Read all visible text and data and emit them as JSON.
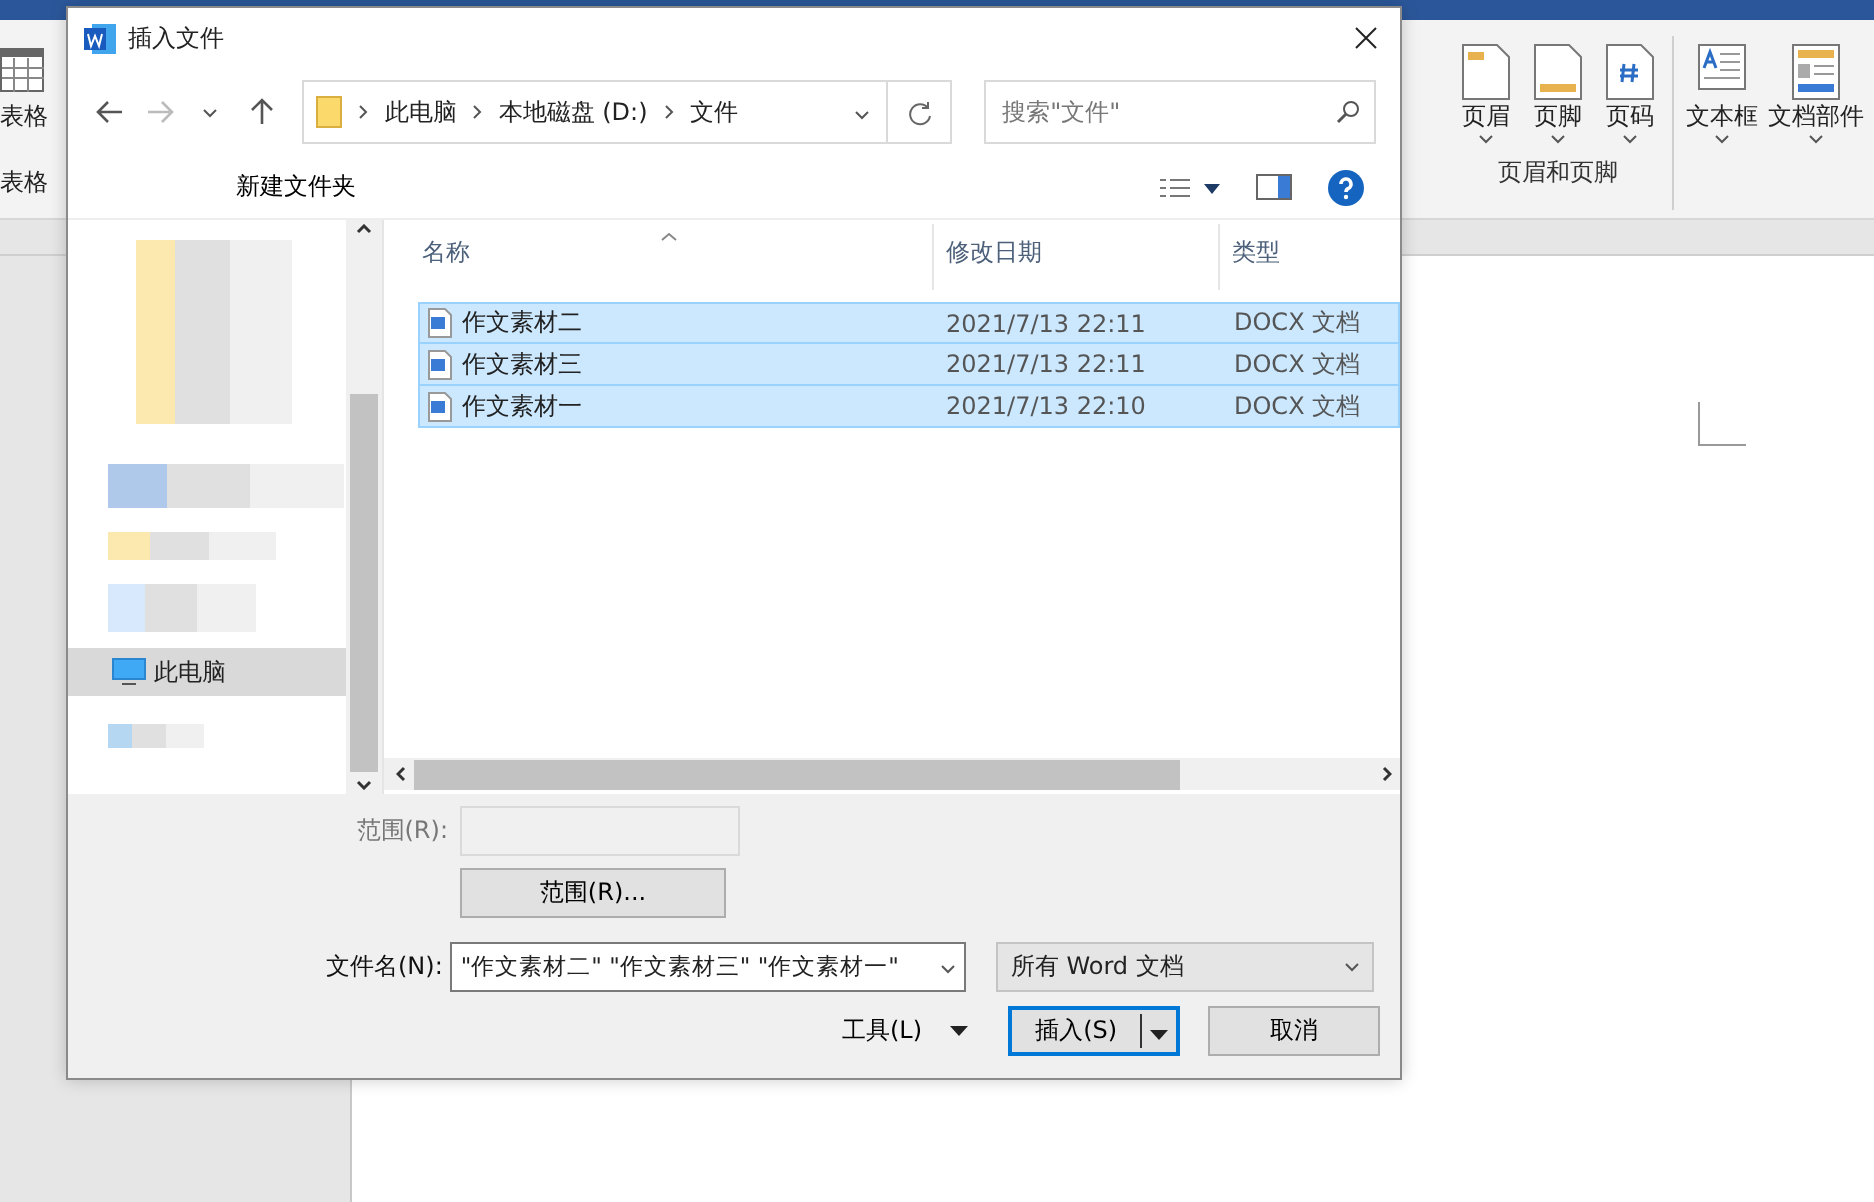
{
  "ribbon": {
    "left_labels": [
      "表格",
      "表格"
    ],
    "groups": [
      {
        "label": "页眉和页脚",
        "buttons": [
          {
            "label": "页眉",
            "kind": "header"
          },
          {
            "label": "页脚",
            "kind": "footer"
          },
          {
            "label": "页码",
            "kind": "pagenum"
          }
        ]
      },
      {
        "buttons": [
          {
            "label": "文本框",
            "kind": "textbox"
          },
          {
            "label": "文档部件",
            "kind": "parts"
          }
        ]
      }
    ]
  },
  "dialog": {
    "title": "插入文件",
    "breadcrumb": [
      "此电脑",
      "本地磁盘 (D:)",
      "文件"
    ],
    "search": {
      "placeholder": "搜索\"文件\""
    },
    "toolbar": {
      "new_folder": "新建文件夹"
    },
    "nav_items": [
      {
        "label": "此电脑",
        "selected": true
      }
    ],
    "columns": [
      "名称",
      "修改日期",
      "类型"
    ],
    "files": [
      {
        "name": "作文素材二",
        "date": "2021/7/13 22:11",
        "type": "DOCX 文档",
        "selected": true
      },
      {
        "name": "作文素材三",
        "date": "2021/7/13 22:11",
        "type": "DOCX 文档",
        "selected": true
      },
      {
        "name": "作文素材一",
        "date": "2021/7/13 22:10",
        "type": "DOCX 文档",
        "selected": true
      }
    ],
    "range_label": "范围(R):",
    "range_button": "范围(R)...",
    "filename_label": "文件名(N):",
    "filename_value": "\"作文素材二\" \"作文素材三\" \"作文素材一\"",
    "filter": "所有 Word 文档",
    "tools": "工具(L)",
    "insert": "插入(S)",
    "cancel": "取消"
  }
}
